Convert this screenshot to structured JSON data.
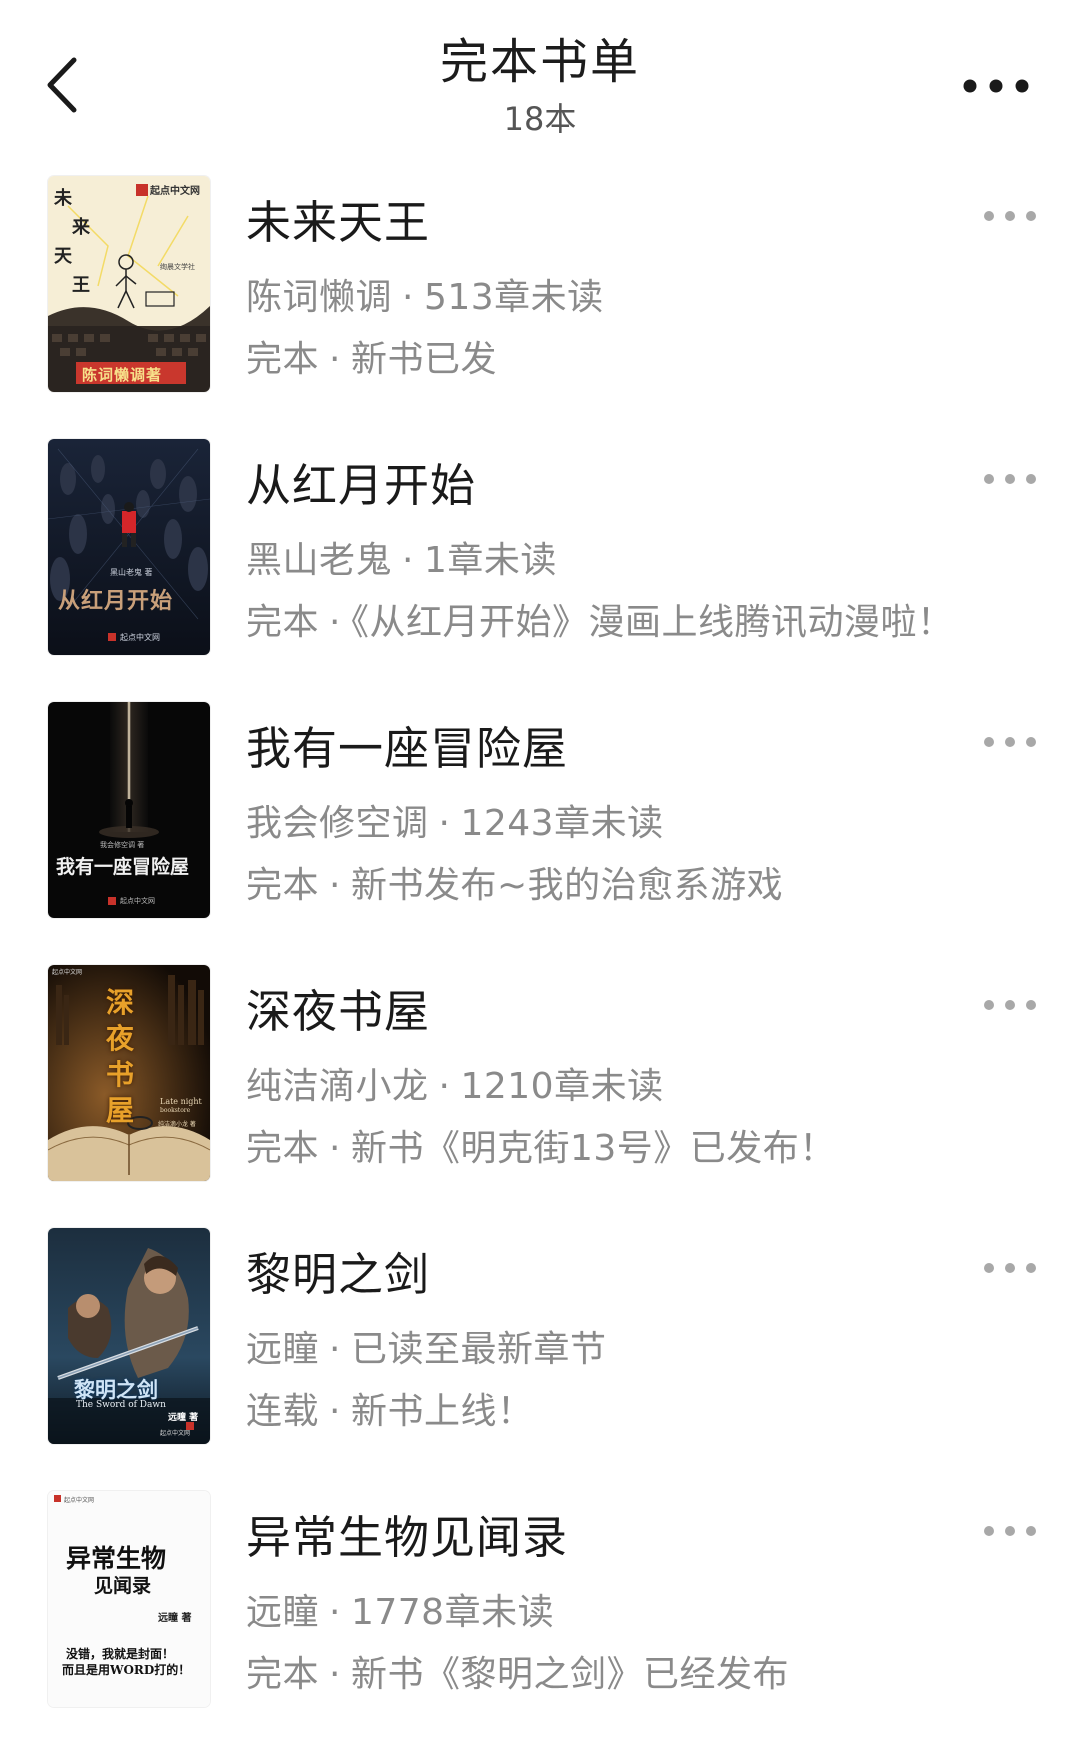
{
  "header": {
    "title": "完本书单",
    "count": "18本",
    "back_icon": "chevron-left-icon",
    "more_icon": "more-horizontal-icon"
  },
  "books": [
    {
      "title": "未来天王",
      "author": "陈词懒调",
      "progress": "513章未读",
      "status": "完本",
      "note": "新书已发",
      "cover": {
        "title_chars": [
          "未",
          "来",
          "天",
          "王"
        ],
        "publisher": "起点中文网",
        "author_band": "陈词懒调著",
        "side_text": "绚晨文学社"
      }
    },
    {
      "title": "从红月开始",
      "author": "黑山老鬼",
      "progress": "1章未读",
      "status": "完本",
      "note": "《从红月开始》漫画上线腾讯动漫啦！",
      "cover": {
        "title": "从红月开始",
        "author_line": "黑山老鬼 著",
        "publisher": "起点中文网"
      }
    },
    {
      "title": "我有一座冒险屋",
      "author": "我会修空调",
      "progress": "1243章未读",
      "status": "完本",
      "note": "新书发布~我的治愈系游戏",
      "cover": {
        "title": "我有一座冒险屋",
        "author_line": "我会修空调 著",
        "publisher": "起点中文网"
      }
    },
    {
      "title": "深夜书屋",
      "author": "纯洁滴小龙",
      "progress": "1210章未读",
      "status": "完本",
      "note": "新书《明克街13号》已发布！",
      "cover": {
        "title_chars": [
          "深",
          "夜",
          "书",
          "屋"
        ],
        "subtitle": "Late night",
        "subtitle2": "bookstore",
        "author_line": "纯洁滴小龙 著",
        "publisher": "起点中文网"
      }
    },
    {
      "title": "黎明之剑",
      "author": "远瞳",
      "progress": "已读至最新章节",
      "status": "连载",
      "note": "新书上线！",
      "cover": {
        "title": "黎明之剑",
        "subtitle": "The Sword of Dawn",
        "author_line": "远瞳 著",
        "publisher": "起点中文网"
      }
    },
    {
      "title": "异常生物见闻录",
      "author": "远瞳",
      "progress": "1778章未读",
      "status": "完本",
      "note": "新书《黎明之剑》已经发布",
      "cover": {
        "publisher": "起点中文网",
        "title_line1": "异常生物",
        "title_line2": "见闻录",
        "author_line": "远瞳 著",
        "tagline1": "没错，我就是封面！",
        "tagline2": "而且是用WORD打的！"
      }
    }
  ],
  "separator": "·"
}
